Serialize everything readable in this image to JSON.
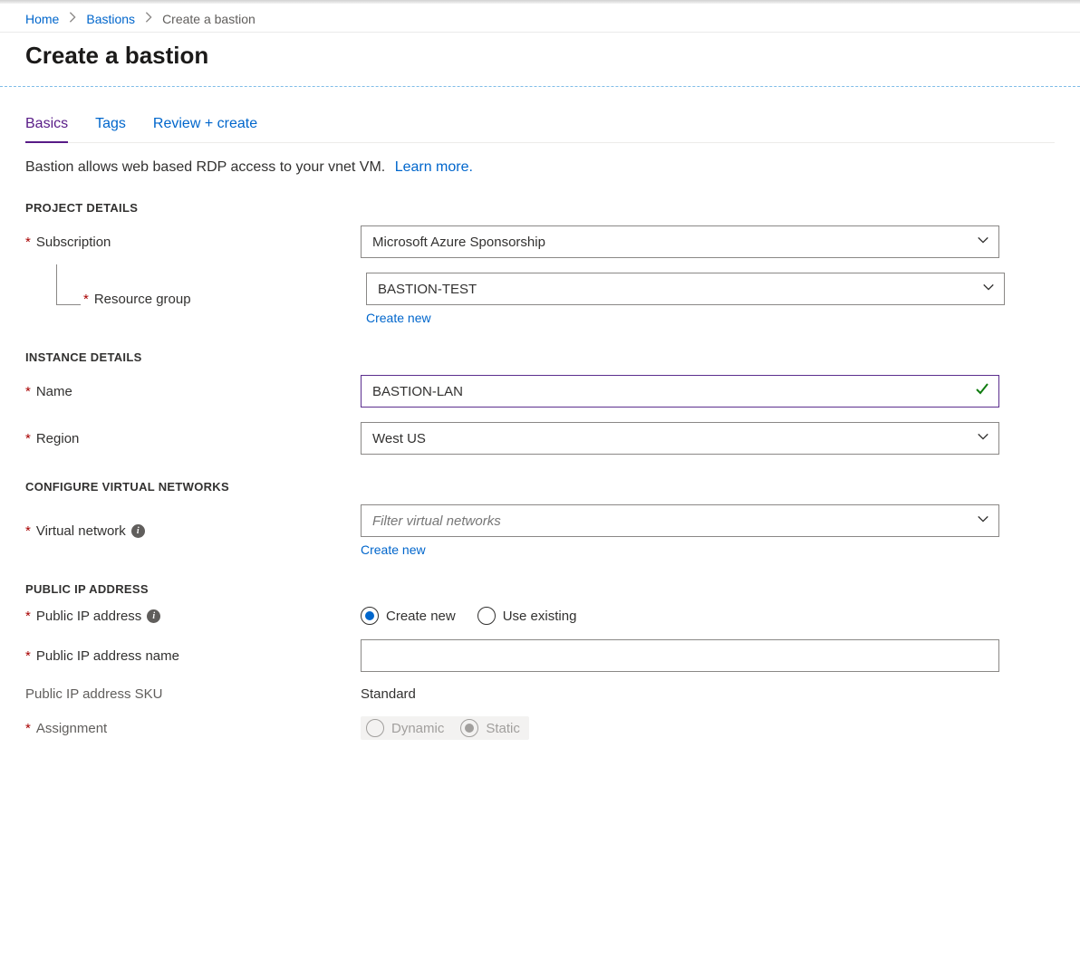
{
  "breadcrumb": {
    "home": "Home",
    "bastions": "Bastions",
    "current": "Create a bastion"
  },
  "page_title": "Create a bastion",
  "tabs": {
    "basics": "Basics",
    "tags": "Tags",
    "review": "Review + create"
  },
  "intro": {
    "text": "Bastion allows web based RDP access to your vnet VM.",
    "learn_more": "Learn more."
  },
  "sections": {
    "project": "PROJECT DETAILS",
    "instance": "INSTANCE DETAILS",
    "vnet": "CONFIGURE VIRTUAL NETWORKS",
    "pip": "PUBLIC IP ADDRESS"
  },
  "labels": {
    "subscription": "Subscription",
    "resource_group": "Resource group",
    "create_new": "Create new",
    "name": "Name",
    "region": "Region",
    "virtual_network": "Virtual network",
    "public_ip": "Public IP address",
    "pip_name": "Public IP address name",
    "pip_sku": "Public IP address SKU",
    "assignment": "Assignment"
  },
  "values": {
    "subscription": "Microsoft Azure Sponsorship",
    "resource_group": "BASTION-TEST",
    "name": "BASTION-LAN",
    "region": "West US",
    "vnet_placeholder": "Filter virtual networks",
    "pip_name": "",
    "pip_sku": "Standard"
  },
  "radios": {
    "pip_create": "Create new",
    "pip_use": "Use existing",
    "assign_dynamic": "Dynamic",
    "assign_static": "Static"
  }
}
